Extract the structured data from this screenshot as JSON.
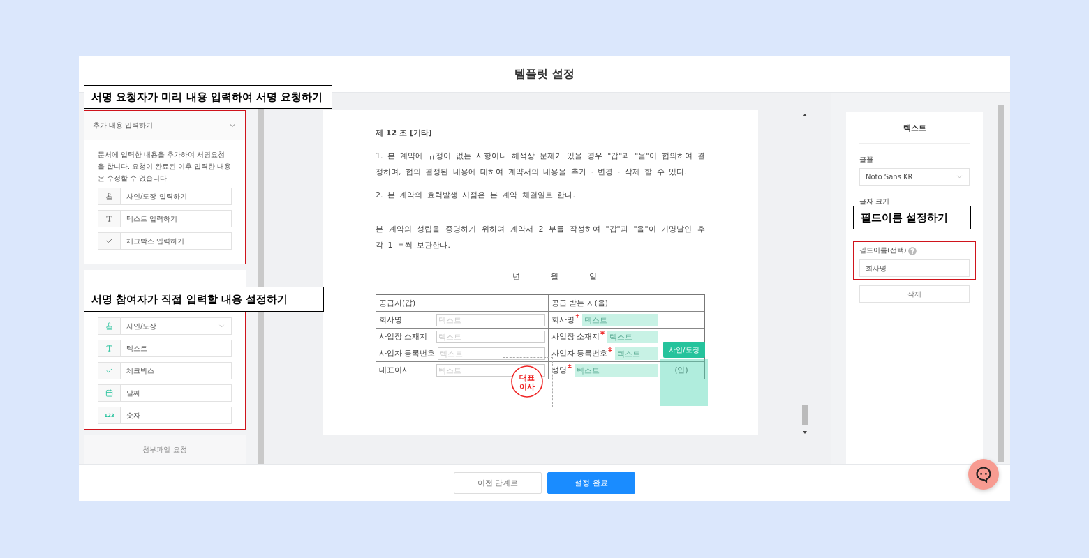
{
  "header": {
    "title": "템플릿 설정"
  },
  "prefill": {
    "callout": "서명 요청자가 미리 내용 입력하여 서명 요청하기",
    "title": "추가 내용 입력하기",
    "expanded": true,
    "description": "문서에 입력한 내용을 추가하여 서명요청을 합니다. 요청이 완료된 이후 입력한 내용은 수정할 수 없습니다.",
    "items": [
      {
        "kind": "sign",
        "label": "사인/도장 입력하기"
      },
      {
        "kind": "text",
        "label": "텍스트 입력하기"
      },
      {
        "kind": "check",
        "label": "체크박스 입력하기"
      }
    ]
  },
  "participant": {
    "callout": "서명 참여자가 직접 입력할 내용 설정하기",
    "fields": [
      {
        "kind": "sign",
        "label": "사인/도장",
        "dropdown": true
      },
      {
        "kind": "text",
        "label": "텍스트",
        "dropdown": false
      },
      {
        "kind": "check",
        "label": "체크박스",
        "dropdown": false
      },
      {
        "kind": "date",
        "label": "날짜",
        "dropdown": false
      },
      {
        "kind": "number",
        "label": "숫자",
        "icon_text": "123",
        "dropdown": false
      }
    ]
  },
  "attachment": {
    "label": "첨부파일 요청"
  },
  "document": {
    "heading": "제 12 조 [기타]",
    "paragraphs": [
      "1. 본 계약에 규정이 없는 사항이나 해석상 문제가 있을 경우 \"갑\"과 \"을\"이 협의하여 결정하며, 협의 결정된 내용에 대하여 계약서의 내용을 추가 · 변경 · 삭제 할 수 있다.",
      "2. 본 계약의 효력발생 시점은 본 계약 체결일로 한다.",
      "본 계약의 성립을 증명하기 위하여 계약서 2 부를 작성하여 \"갑\"과 \"을\"이 기명날인 후 각 1 부씩 보관한다."
    ],
    "date": [
      "년",
      "월",
      "일"
    ],
    "table": {
      "columns": [
        "공급자(갑)",
        "공급 받는 자(을)"
      ],
      "rows": [
        {
          "supplier_label": "회사명",
          "supplier_placeholder": "텍스트",
          "recipient_label": "회사명",
          "required": true,
          "recipient_placeholder": "텍스트"
        },
        {
          "supplier_label": "사업장 소재지",
          "supplier_placeholder": "텍스트",
          "recipient_label": "사업장 소재지",
          "required": true,
          "recipient_placeholder": "텍스트"
        },
        {
          "supplier_label": "사업자 등록번호",
          "supplier_placeholder": "텍스트",
          "recipient_label": "사업자 등록번호",
          "required": true,
          "recipient_placeholder": "텍스트"
        },
        {
          "supplier_label": "대표이사",
          "supplier_placeholder": "텍스트",
          "recipient_label": "성명",
          "required": true,
          "recipient_placeholder": "텍스트",
          "seal_mark": "(인)"
        }
      ]
    },
    "stamp_text": [
      "대표",
      "이사"
    ],
    "sign_tag": "사인/도장"
  },
  "properties": {
    "title": "텍스트",
    "font_label": "글꼴",
    "font": "Noto Sans KR",
    "size_label": "글자 크기",
    "callout": "필드이름 설정하기",
    "field_name_label": "필드이름(선택)",
    "field_name": "회사명",
    "delete": "삭제"
  },
  "footer": {
    "prev": "이전 단계로",
    "done": "설정 완료"
  }
}
